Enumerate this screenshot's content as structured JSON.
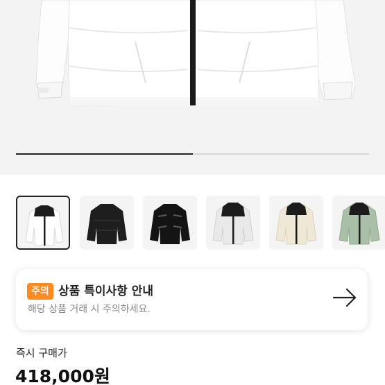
{
  "gallery": {
    "progress_fraction": 0.5,
    "thumbnails": [
      {
        "icon": "jacket-white-black-thumbnail",
        "selected": true
      },
      {
        "icon": "jacket-black-matte-thumbnail",
        "selected": false
      },
      {
        "icon": "jacket-black-glossy-thumbnail",
        "selected": false
      },
      {
        "icon": "jacket-light-gray-thumbnail",
        "selected": false
      },
      {
        "icon": "jacket-cream-thumbnail",
        "selected": false
      },
      {
        "icon": "jacket-sage-green-thumbnail",
        "selected": false
      }
    ]
  },
  "notice": {
    "badge": "주의",
    "title": "상품 특이사항 안내",
    "subtitle": "해당 상품 거래 시 주의하세요.",
    "icon": "arrow-right-icon"
  },
  "price": {
    "label": "즉시 구매가",
    "value": "418,000원"
  },
  "colors": {
    "badge": "#ff8a1f",
    "text": "#222222",
    "muted": "#8a8a8a"
  }
}
